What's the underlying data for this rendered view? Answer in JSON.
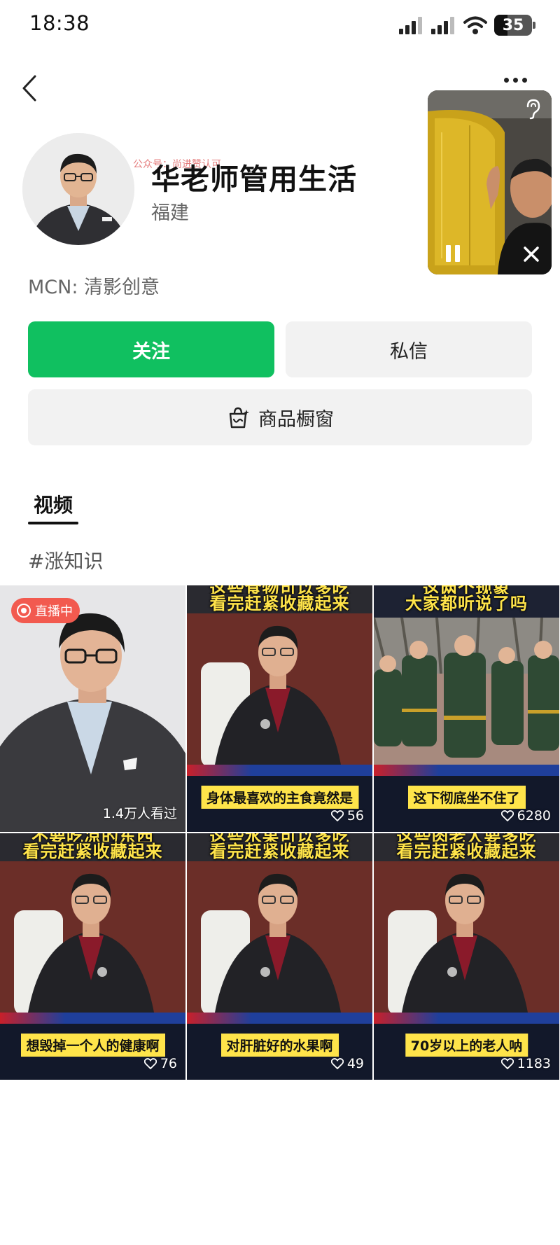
{
  "status_bar": {
    "time": "18:38",
    "battery": "35",
    "battery_level": 0.35
  },
  "profile": {
    "watermark": "公众号：尚进赞认可",
    "name": "华老师管用生活",
    "region": "福建",
    "mcn": "MCN: 清影创意"
  },
  "actions": {
    "follow": "关注",
    "message": "私信",
    "shop": "商品橱窗"
  },
  "tabs": [
    {
      "label": "视频",
      "active": true
    }
  ],
  "hashtag": "#涨知识",
  "colors": {
    "follow_green": "#10c060",
    "live_red": "#f25a4f",
    "caption_yellow": "#ffe44a"
  },
  "videos": [
    {
      "live_label": "直播中",
      "viewers": "1.4万人看过"
    },
    {
      "headline_top": "这些食物可以多吃",
      "headline": "看完赶紧收藏起来",
      "caption": "身体最喜欢的主食竟然是",
      "likes": "56"
    },
    {
      "headline_top": "这两个现象",
      "headline": "大家都听说了吗",
      "caption": "这下彻底坐不住了",
      "likes": "6280"
    },
    {
      "headline_top": "不要吃凉的东西",
      "headline": "看完赶紧收藏起来",
      "caption": "想毁掉一个人的健康啊",
      "likes": "76"
    },
    {
      "headline_top": "这些水果可以多吃",
      "headline": "看完赶紧收藏起来",
      "caption": "对肝脏好的水果啊",
      "likes": "49"
    },
    {
      "headline_top": "这些肉老人要多吃",
      "headline": "看完赶紧收藏起来",
      "caption": "70岁以上的老人呐",
      "likes": "1183"
    }
  ]
}
